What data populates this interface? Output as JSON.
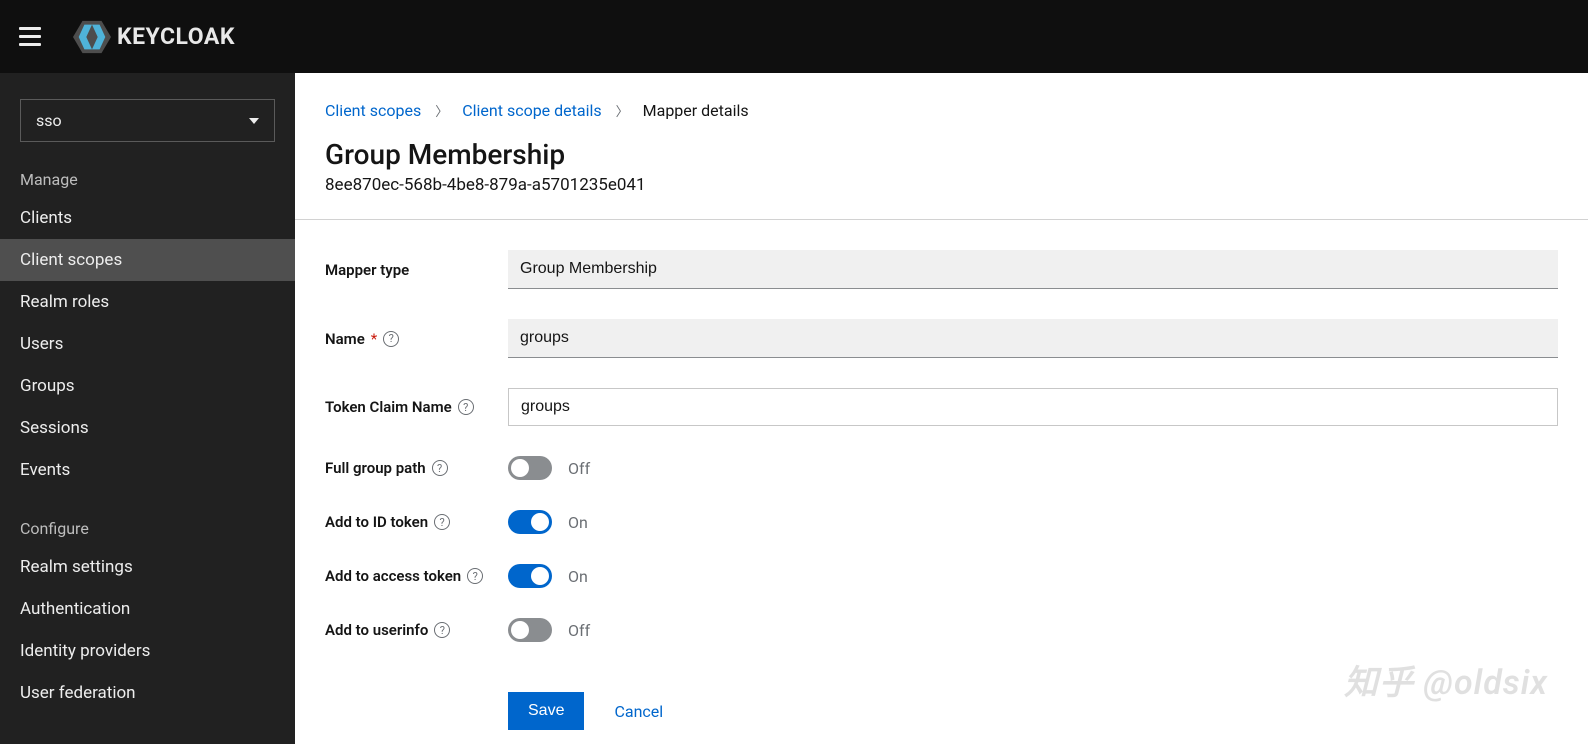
{
  "brand": {
    "name": "KEYCLOAK"
  },
  "sidebar": {
    "realm": "sso",
    "sections": [
      {
        "label": "Manage",
        "items": [
          "Clients",
          "Client scopes",
          "Realm roles",
          "Users",
          "Groups",
          "Sessions",
          "Events"
        ],
        "active_index": 1
      },
      {
        "label": "Configure",
        "items": [
          "Realm settings",
          "Authentication",
          "Identity providers",
          "User federation"
        ],
        "active_index": -1
      }
    ]
  },
  "breadcrumb": {
    "items": [
      {
        "label": "Client scopes",
        "link": true
      },
      {
        "label": "Client scope details",
        "link": true
      },
      {
        "label": "Mapper details",
        "link": false
      }
    ]
  },
  "page": {
    "title": "Group Membership",
    "id": "8ee870ec-568b-4be8-879a-a5701235e041"
  },
  "form": {
    "mapper_type": {
      "label": "Mapper type",
      "value": "Group Membership"
    },
    "name": {
      "label": "Name",
      "required": true,
      "value": "groups"
    },
    "token_claim_name": {
      "label": "Token Claim Name",
      "value": "groups"
    },
    "full_group_path": {
      "label": "Full group path",
      "on": false,
      "state": "Off"
    },
    "add_to_id_token": {
      "label": "Add to ID token",
      "on": true,
      "state": "On"
    },
    "add_to_access_token": {
      "label": "Add to access token",
      "on": true,
      "state": "On"
    },
    "add_to_userinfo": {
      "label": "Add to userinfo",
      "on": false,
      "state": "Off"
    },
    "save": "Save",
    "cancel": "Cancel"
  },
  "watermark": "知乎 @oldsix"
}
